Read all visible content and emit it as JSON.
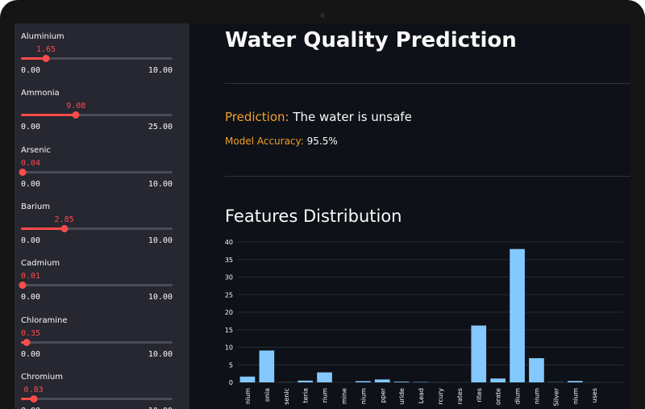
{
  "sidebar": {
    "sliders": [
      {
        "label": "Aluminium",
        "value": "1.65",
        "min": "0.00",
        "max": "10.00",
        "fraction": 0.165
      },
      {
        "label": "Ammonia",
        "value": "9.08",
        "min": "0.00",
        "max": "25.00",
        "fraction": 0.3632
      },
      {
        "label": "Arsenic",
        "value": "0.04",
        "min": "0.00",
        "max": "10.00",
        "fraction": 0.004
      },
      {
        "label": "Barium",
        "value": "2.85",
        "min": "0.00",
        "max": "10.00",
        "fraction": 0.285
      },
      {
        "label": "Cadmium",
        "value": "0.01",
        "min": "0.00",
        "max": "10.00",
        "fraction": 0.001
      },
      {
        "label": "Chloramine",
        "value": "0.35",
        "min": "0.00",
        "max": "10.00",
        "fraction": 0.035
      },
      {
        "label": "Chromium",
        "value": "0.83",
        "min": "0.00",
        "max": "10.00",
        "fraction": 0.083
      }
    ]
  },
  "main": {
    "title": "Water Quality Prediction",
    "prediction_label": "Prediction:",
    "prediction_value": "The water is unsafe",
    "accuracy_label": "Model Accuracy:",
    "accuracy_value": "95.5%",
    "features_title": "Features Distribution"
  },
  "colors": {
    "accent": "#ff4b4b",
    "heading_accent": "#f0a02b",
    "bar": "#83c9ff",
    "background": "#0e1117",
    "sidebar": "#262730"
  },
  "chart_data": {
    "type": "bar",
    "categories": [
      "nium",
      "onia",
      "senic",
      "teria",
      "rium",
      "mine",
      "nium",
      "pper",
      "uride",
      "Lead",
      "rcury",
      "rates",
      "rites",
      "orate",
      "dium",
      "nium",
      "Silver",
      "nium",
      "uses"
    ],
    "values": [
      1.65,
      9.08,
      0.04,
      0.5,
      2.85,
      0.01,
      0.35,
      0.83,
      0.2,
      0.1,
      0.02,
      0.005,
      16.2,
      1.1,
      38.0,
      6.9,
      0.05,
      0.4,
      0.02,
      0.0
    ],
    "yticks": [
      0,
      5,
      10,
      15,
      20,
      25,
      30,
      35,
      40
    ],
    "ylim": [
      0,
      40
    ],
    "grid": true
  }
}
